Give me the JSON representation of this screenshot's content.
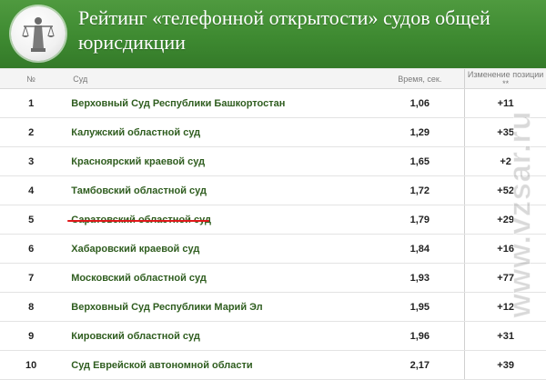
{
  "header": {
    "title": "Рейтинг «телефонной открытости» судов общей юрисдикции",
    "emblem_icon": "themis-justice-icon"
  },
  "table": {
    "columns": [
      "№",
      "Суд",
      "Время, сек.",
      "Изменение позиции **"
    ],
    "rows": [
      {
        "num": "1",
        "court": "Верховный Суд Республики Башкортостан",
        "time": "1,06",
        "change": "+11"
      },
      {
        "num": "2",
        "court": "Калужский областной суд",
        "time": "1,29",
        "change": "+35"
      },
      {
        "num": "3",
        "court": "Красноярский краевой суд",
        "time": "1,65",
        "change": "+2"
      },
      {
        "num": "4",
        "court": "Тамбовский областной суд",
        "time": "1,72",
        "change": "+52"
      },
      {
        "num": "5",
        "court": "Саратовский областной суд",
        "time": "1,79",
        "change": "+29"
      },
      {
        "num": "6",
        "court": "Хабаровский краевой суд",
        "time": "1,84",
        "change": "+16"
      },
      {
        "num": "7",
        "court": "Московский областной суд",
        "time": "1,93",
        "change": "+77"
      },
      {
        "num": "8",
        "court": "Верховный Суд Республики Марий Эл",
        "time": "1,95",
        "change": "+12"
      },
      {
        "num": "9",
        "court": "Кировский областной суд",
        "time": "1,96",
        "change": "+31"
      },
      {
        "num": "10",
        "court": "Суд Еврейской автономной области",
        "time": "2,17",
        "change": "+39"
      }
    ]
  },
  "highlight": {
    "row": "5",
    "color": "#e0191b"
  },
  "watermark": {
    "text": "www.vzsar.ru"
  },
  "colors": {
    "banner": "#3e8a31",
    "court_text": "#2f5d1f"
  }
}
